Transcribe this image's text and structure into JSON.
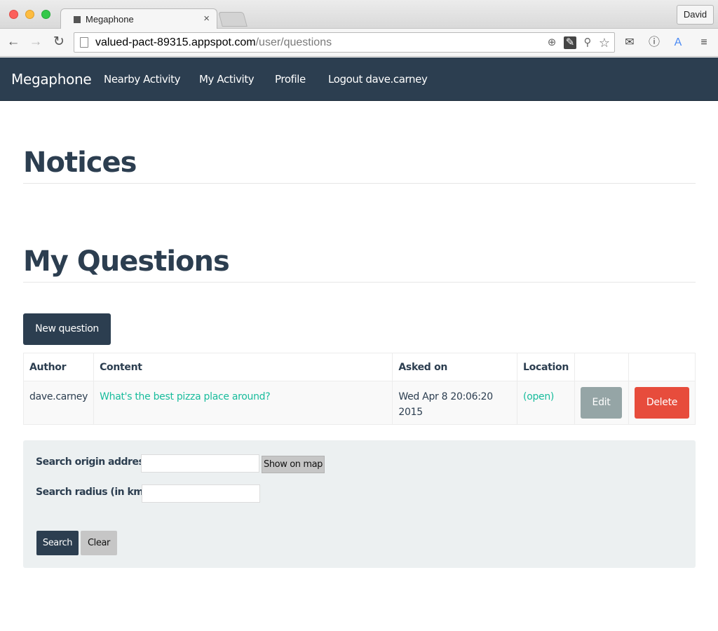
{
  "browser": {
    "tab_title": "Megaphone",
    "tab_close": "×",
    "profile_name": "David",
    "url_host": "valued-pact-89315.appspot.com",
    "url_path": "/user/questions"
  },
  "navbar": {
    "brand": "Megaphone",
    "links": [
      "Nearby Activity",
      "My Activity",
      "Profile",
      "Logout dave.carney"
    ]
  },
  "notices": {
    "heading": "Notices"
  },
  "questions": {
    "heading": "My Questions",
    "new_button": "New question",
    "columns": [
      "Author",
      "Content",
      "Asked on",
      "Location",
      "",
      ""
    ],
    "rows": [
      {
        "author": "dave.carney",
        "content": "What's the best pizza place around?",
        "asked_on": "Wed Apr 8 20:06:20 2015",
        "location": "(open)",
        "edit": "Edit",
        "delete": "Delete"
      }
    ]
  },
  "search": {
    "origin_label": "Search origin address",
    "origin_value": "",
    "show_map": "Show on map",
    "radius_label": "Search radius (in km)",
    "radius_value": "",
    "search_button": "Search",
    "clear_button": "Clear"
  },
  "colors": {
    "navbar": "#2c3e50",
    "accent_link": "#18bc9c",
    "delete": "#e74c3c",
    "edit": "#95a5a6"
  }
}
